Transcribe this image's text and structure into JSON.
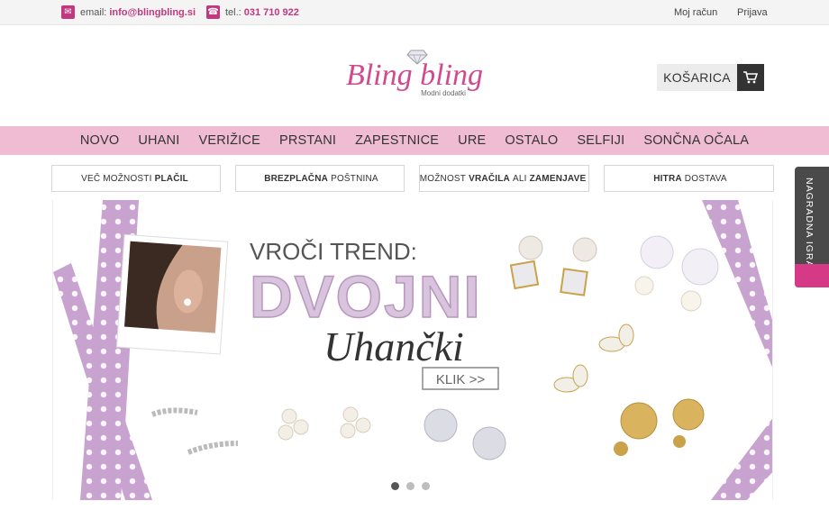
{
  "topbar": {
    "email_label": "email:",
    "email_value": "info@blingbling.si",
    "phone_label": "tel.:",
    "phone_value": "031 710 922",
    "account_link": "Moj račun",
    "login_link": "Prijava"
  },
  "header": {
    "logo_text": "Bling bling",
    "logo_tagline": "Modni dodatki",
    "cart_label": "KOŠARICA"
  },
  "nav": {
    "items": [
      "NOVO",
      "UHANI",
      "VERIŽICE",
      "PRSTANI",
      "ZAPESTNICE",
      "URE",
      "OSTALO",
      "SELFIJI",
      "SONČNA OČALA"
    ]
  },
  "features": [
    {
      "pre": "VEČ MOŽNOSTI",
      "bold": "PLAČIL",
      "mid": "",
      "bold2": "",
      "post": ""
    },
    {
      "pre": "",
      "bold": "BREZPLAČNA",
      "mid": "POŠTNINA",
      "bold2": "",
      "post": ""
    },
    {
      "pre": "MOŽNOST",
      "bold": "VRAČILA",
      "mid": "ALI",
      "bold2": "ZAMENJAVE",
      "post": ""
    },
    {
      "pre": "",
      "bold": "HITRA",
      "mid": "DOSTAVA",
      "bold2": "",
      "post": ""
    }
  ],
  "banner": {
    "line1": "VROČI TREND:",
    "line2": "DVOJNI",
    "line3": "Uhančki",
    "cta": "KLIK >>",
    "slides_total": 3,
    "slide_active": 1
  },
  "side_tab": {
    "label": "NAGRADNA IGRA"
  },
  "colors": {
    "brand_pink": "#c2387f",
    "nav_pink": "#f0bcd3",
    "ribbon_lilac": "#c9a3cf",
    "dark": "#333333"
  }
}
